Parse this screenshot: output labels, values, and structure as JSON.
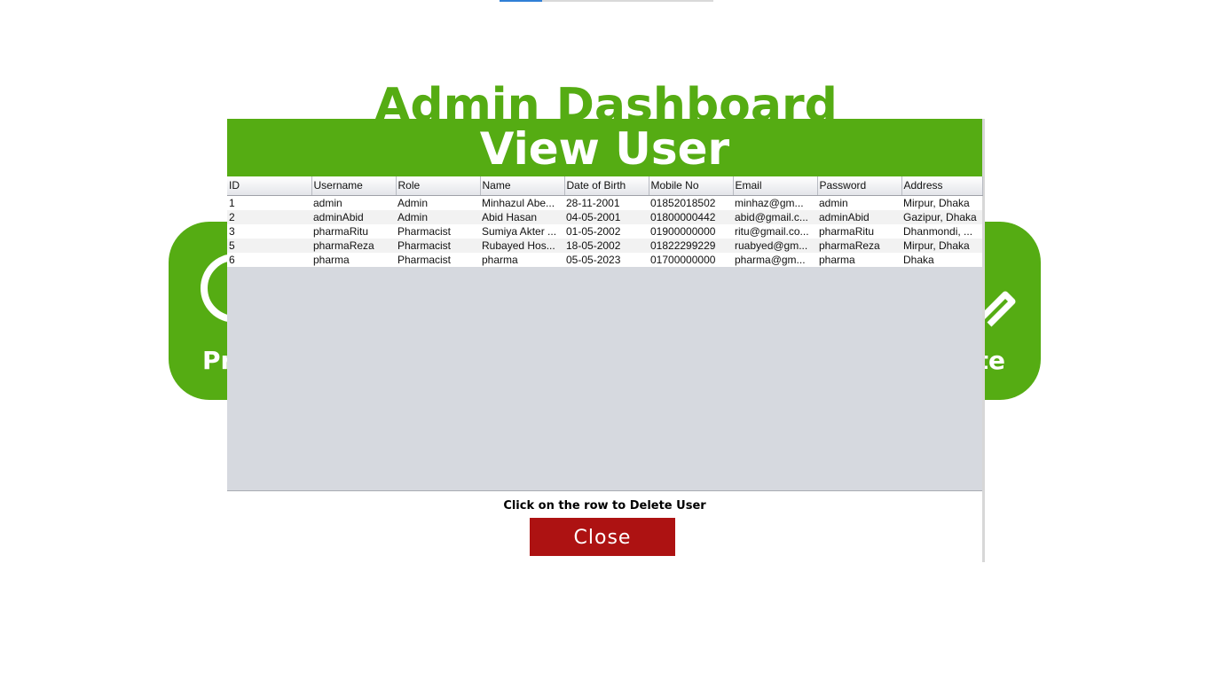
{
  "dashboard": {
    "title": "Admin Dashboard",
    "cards": [
      {
        "label": "Pr",
        "icon": "profile-icon"
      },
      {
        "label": "te",
        "icon": "pencil-icon"
      }
    ]
  },
  "modal": {
    "title": "View User",
    "hint": "Click on the row to Delete User",
    "close_label": "Close",
    "columns": [
      "ID",
      "Username",
      "Role",
      "Name",
      "Date of Birth",
      "Mobile No",
      "Email",
      "Password",
      "Address"
    ],
    "rows": [
      [
        "1",
        "admin",
        "Admin",
        "Minhazul Abe...",
        "28-11-2001",
        "01852018502",
        "minhaz@gm...",
        "admin",
        "Mirpur, Dhaka"
      ],
      [
        "2",
        "adminAbid",
        "Admin",
        "Abid Hasan",
        "04-05-2001",
        "01800000442",
        "abid@gmail.c...",
        "adminAbid",
        "Gazipur, Dhaka"
      ],
      [
        "3",
        "pharmaRitu",
        "Pharmacist",
        "Sumiya Akter ...",
        "01-05-2002",
        "01900000000",
        "ritu@gmail.co...",
        "pharmaRitu",
        "Dhanmondi, ..."
      ],
      [
        "5",
        "pharmaReza",
        "Pharmacist",
        "Rubayed Hos...",
        "18-05-2002",
        "01822299229",
        "ruabyed@gm...",
        "pharmaReza",
        "Mirpur, Dhaka"
      ],
      [
        "6",
        "pharma",
        "Pharmacist",
        "pharma",
        "05-05-2023",
        "01700000000",
        "pharma@gm...",
        "pharma",
        "Dhaka"
      ]
    ]
  },
  "colors": {
    "brand_green": "#55ac13",
    "close_red": "#ad1212"
  }
}
